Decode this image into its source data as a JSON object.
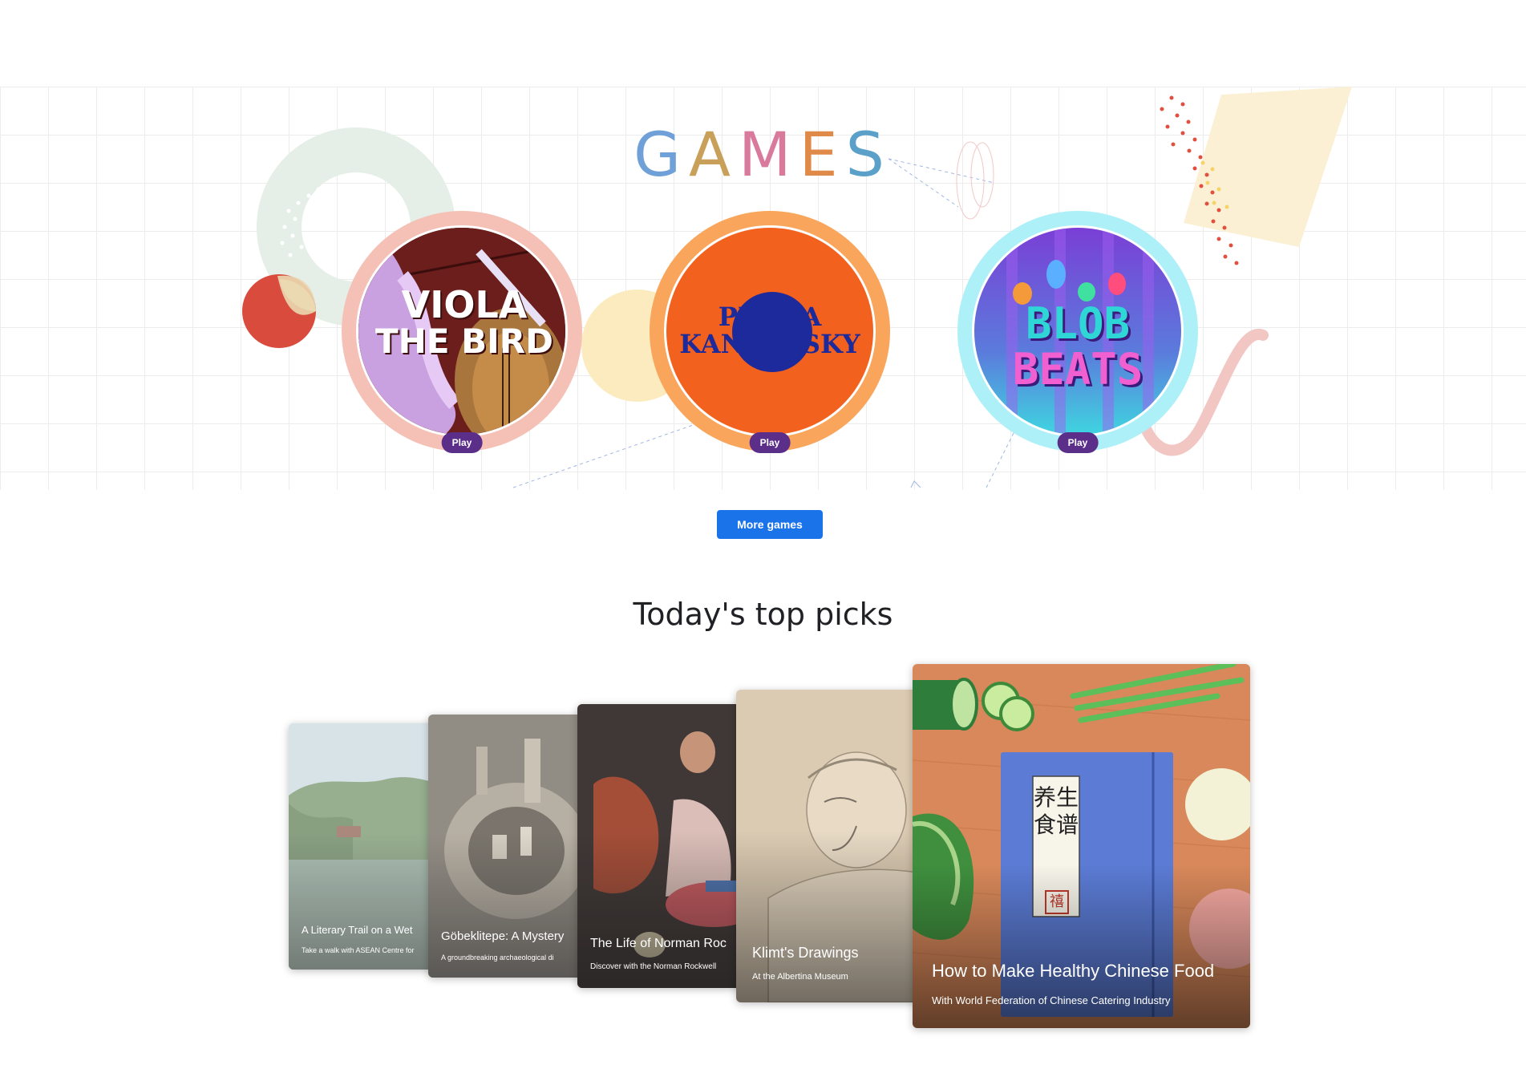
{
  "games": {
    "title": "GAMES",
    "title_letters": [
      "G",
      "A",
      "M",
      "E",
      "S"
    ],
    "items": [
      {
        "name": "Viola the Bird",
        "art_line1": "VIOLA",
        "art_line2": "THE BIRD",
        "play_label": "Play",
        "ring_color": "#f5c1b7"
      },
      {
        "name": "Play a Kandinsky",
        "art_line1": "PLAY A",
        "art_line2": "KANDINSKY",
        "play_label": "Play",
        "ring_color": "#f9a65c"
      },
      {
        "name": "Blob Beats",
        "art_line1": "BLOB",
        "art_line2": "BEATS",
        "play_label": "Play",
        "ring_color": "#aef0f7"
      }
    ],
    "more_label": "More games"
  },
  "top_picks": {
    "title": "Today's top picks",
    "items": [
      {
        "title": "A Literary Trail on a Wet",
        "subtitle": "Take a walk with ASEAN Centre for"
      },
      {
        "title": "Göbeklitepe: A Mystery",
        "subtitle": "A groundbreaking archaeological di"
      },
      {
        "title": "The Life of Norman Roc",
        "subtitle": "Discover with the Norman Rockwell"
      },
      {
        "title": "Klimt's Drawings",
        "subtitle": "At the Albertina Museum"
      },
      {
        "title": "How to Make Healthy Chinese Food",
        "subtitle": "With World Federation of Chinese Catering Industry",
        "book_title": "养生食谱",
        "seal": "禧"
      }
    ]
  },
  "colors": {
    "primary_button": "#1a73e8",
    "play_pill": "#5b2e8a",
    "kandinsky_orange": "#f2611d",
    "kandinsky_navy": "#1d2a9c"
  }
}
